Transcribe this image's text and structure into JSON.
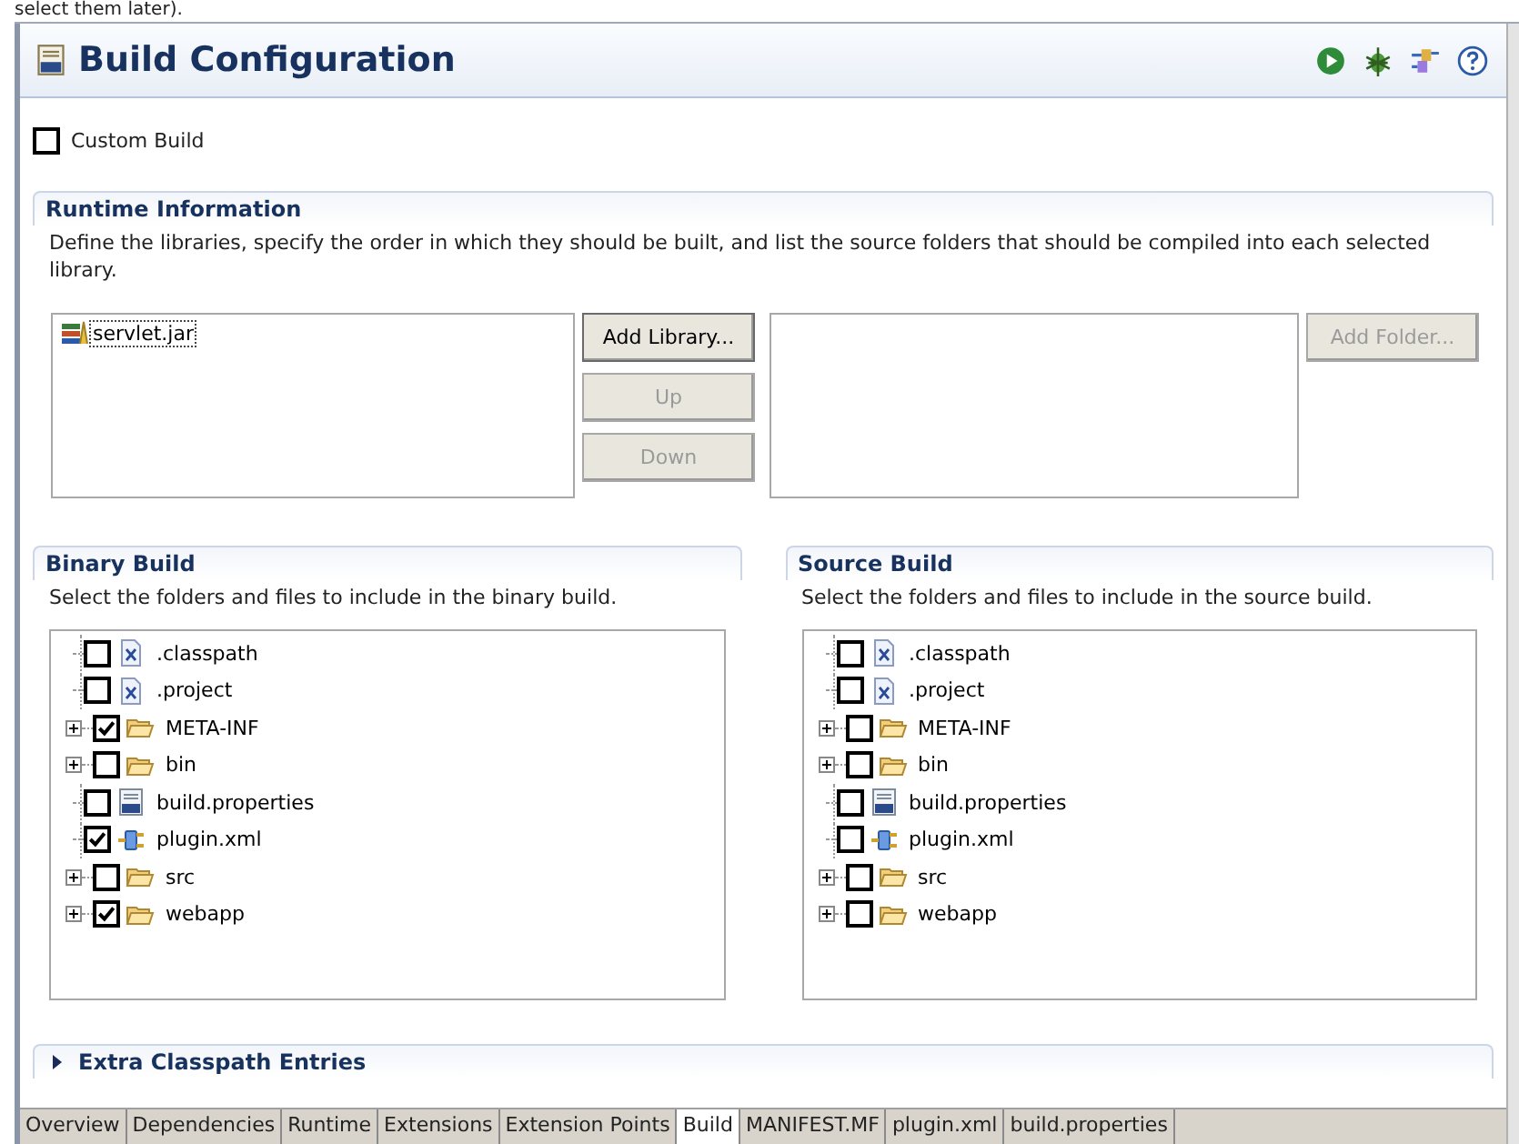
{
  "caption_above": "select them later).",
  "editor": {
    "title": "Build Configuration"
  },
  "custom_build": {
    "label": "Custom Build",
    "checked": false
  },
  "runtime": {
    "title": "Runtime Information",
    "description": "Define the libraries, specify the order in which they should be built, and list the source folders that should be compiled into each selected library.",
    "libraries": [
      {
        "label": "servlet.jar",
        "selected": true
      }
    ],
    "library_buttons": [
      {
        "label": "Add Library...",
        "disabled": false
      },
      {
        "label": "Up",
        "disabled": true
      },
      {
        "label": "Down",
        "disabled": true
      }
    ],
    "folder_buttons": [
      {
        "label": "Add Folder...",
        "disabled": true
      }
    ]
  },
  "build_sections": [
    {
      "title": "Binary Build",
      "description": "Select the folders and files to include in the binary build.",
      "items": [
        {
          "label": ".classpath",
          "kind": "xml",
          "checked": false
        },
        {
          "label": ".project",
          "kind": "xml",
          "checked": false
        },
        {
          "label": "META-INF",
          "kind": "folder",
          "checked": true
        },
        {
          "label": "bin",
          "kind": "folder",
          "checked": false
        },
        {
          "label": "build.properties",
          "kind": "properties",
          "checked": false
        },
        {
          "label": "plugin.xml",
          "kind": "plugin",
          "checked": true
        },
        {
          "label": "src",
          "kind": "folder",
          "checked": false
        },
        {
          "label": "webapp",
          "kind": "folder",
          "checked": true
        }
      ]
    },
    {
      "title": "Source Build",
      "description": "Select the folders and files to include in the source build.",
      "items": [
        {
          "label": ".classpath",
          "kind": "xml",
          "checked": false
        },
        {
          "label": ".project",
          "kind": "xml",
          "checked": false
        },
        {
          "label": "META-INF",
          "kind": "folder",
          "checked": false
        },
        {
          "label": "bin",
          "kind": "folder",
          "checked": false
        },
        {
          "label": "build.properties",
          "kind": "properties",
          "checked": false
        },
        {
          "label": "plugin.xml",
          "kind": "plugin",
          "checked": false
        },
        {
          "label": "src",
          "kind": "folder",
          "checked": false
        },
        {
          "label": "webapp",
          "kind": "folder",
          "checked": false
        }
      ]
    }
  ],
  "extra_classpath": {
    "title": "Extra Classpath Entries",
    "expanded": false
  },
  "tabs": [
    {
      "label": "Overview",
      "selected": false
    },
    {
      "label": "Dependencies",
      "selected": false
    },
    {
      "label": "Runtime",
      "selected": false
    },
    {
      "label": "Extensions",
      "selected": false
    },
    {
      "label": "Extension Points",
      "selected": false
    },
    {
      "label": "Build",
      "selected": true
    },
    {
      "label": "MANIFEST.MF",
      "selected": false
    },
    {
      "label": "plugin.xml",
      "selected": false
    },
    {
      "label": "build.properties",
      "selected": false
    }
  ]
}
